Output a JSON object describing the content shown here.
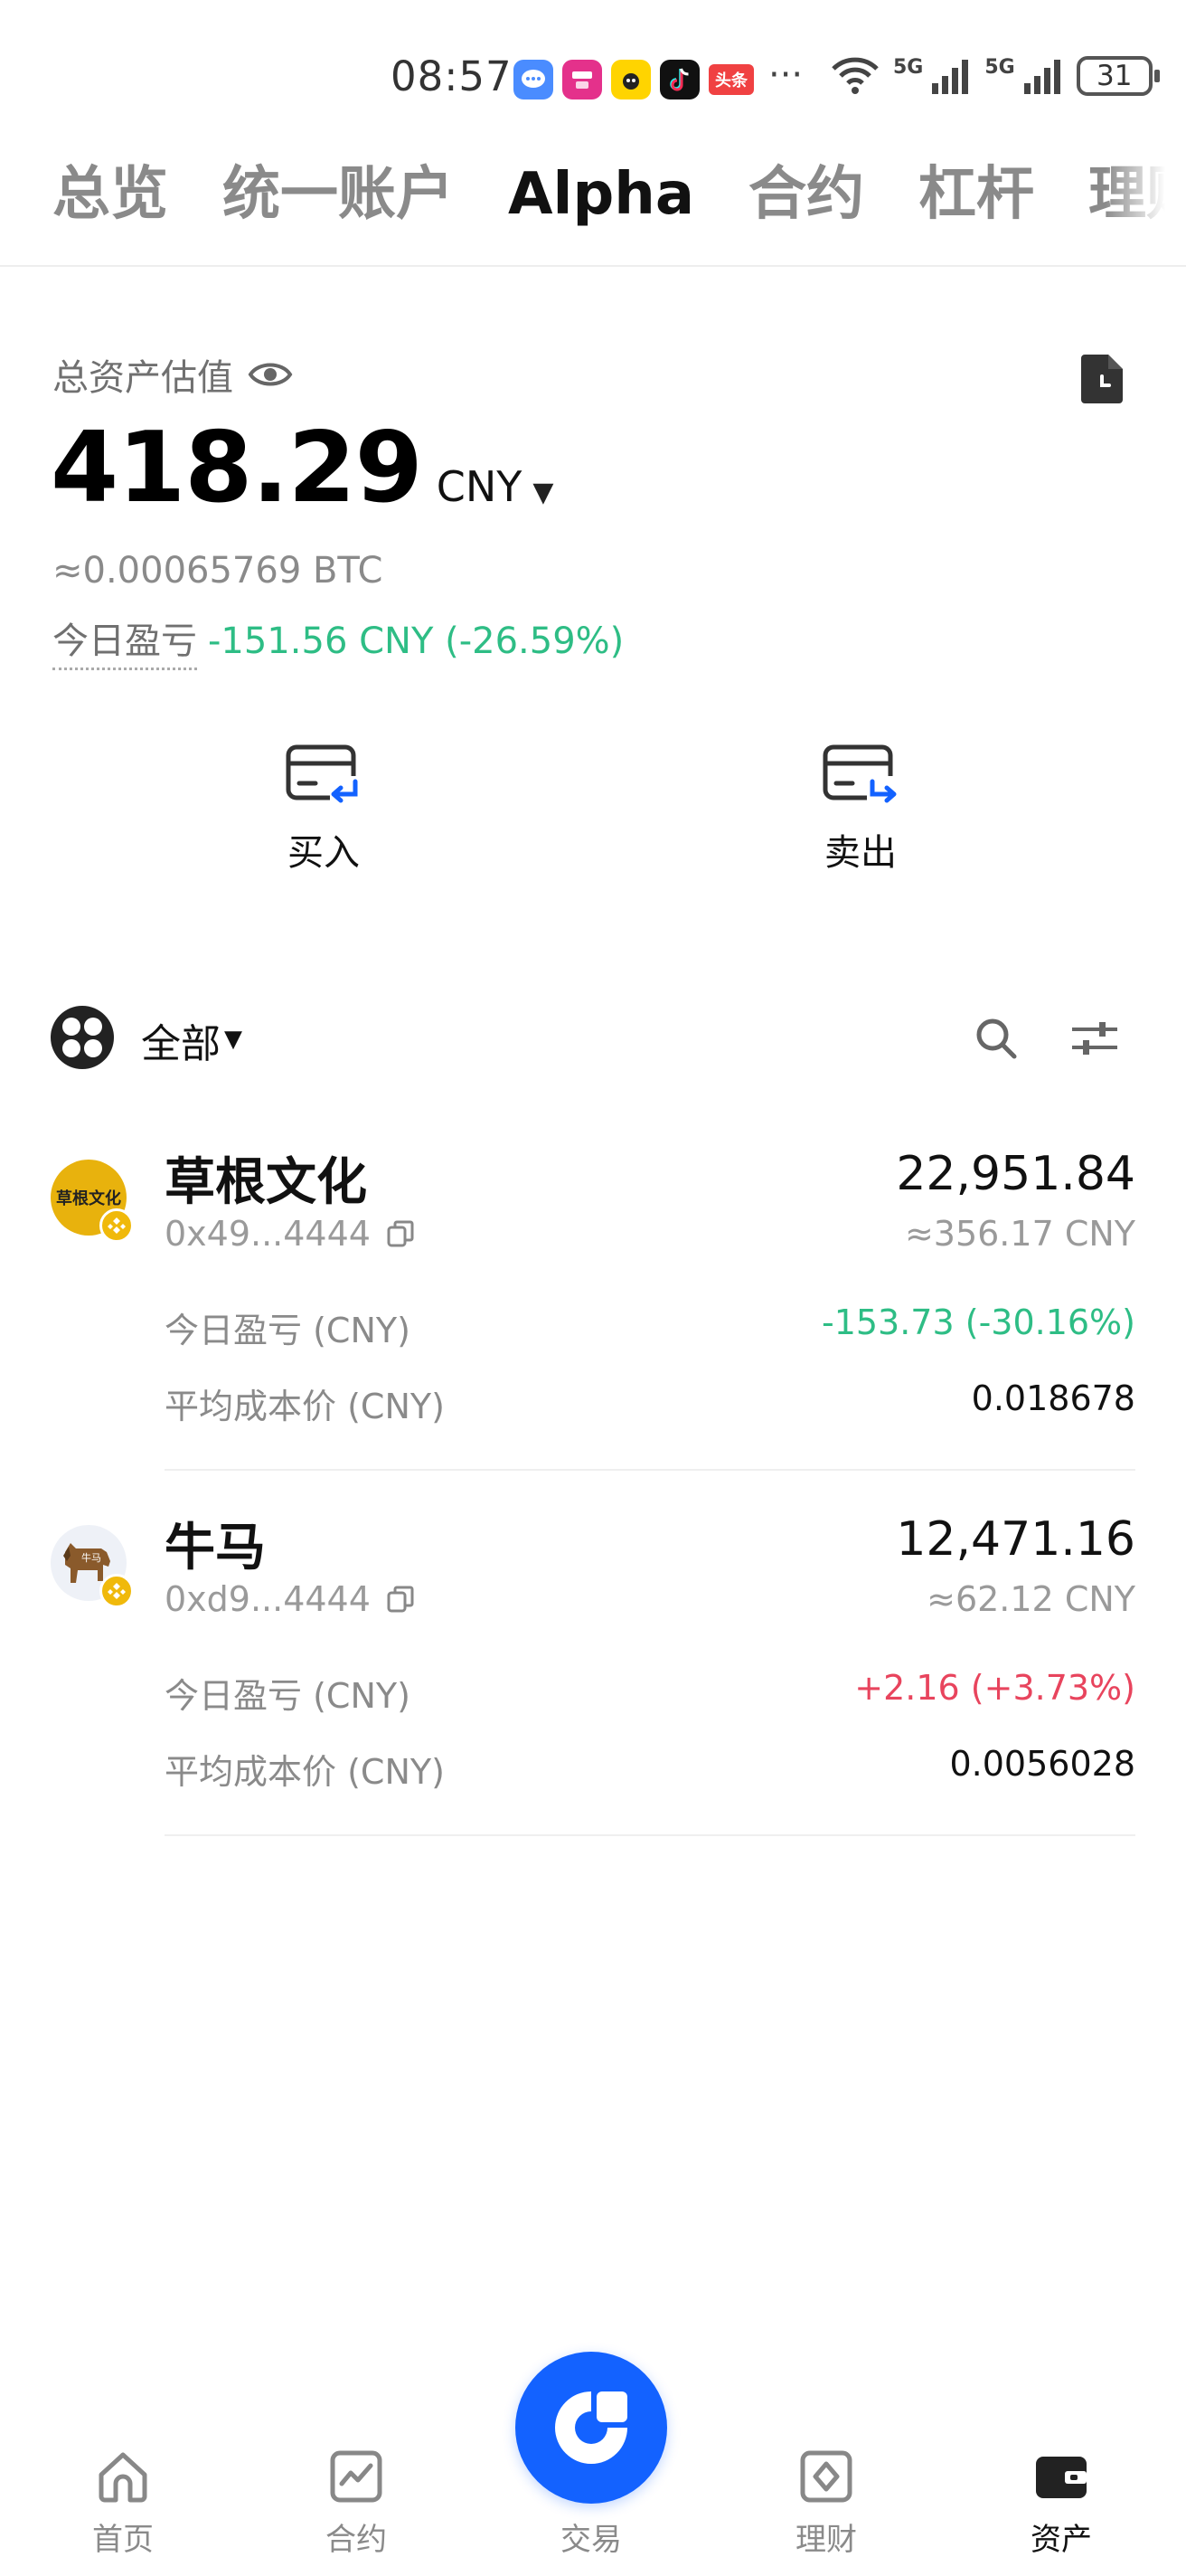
{
  "status_bar": {
    "time": "08:57",
    "app_icons": [
      "message-app-icon",
      "vipshop-app-icon",
      "fanqie-app-icon",
      "tiktok-app-icon",
      "toutiao-app-icon"
    ],
    "toutiao_label": "头条",
    "more": "···",
    "network": [
      "5G",
      "5G"
    ],
    "battery": "31"
  },
  "top_tabs": [
    "总览",
    "统一账户",
    "Alpha",
    "合约",
    "杠杆",
    "理财"
  ],
  "active_tab": "Alpha",
  "summary": {
    "label": "总资产估值",
    "total_value": "418.29",
    "unit": "CNY",
    "btc_value": "≈0.00065769 BTC",
    "pnl_label": "今日盈亏",
    "pnl_value": "-151.56 CNY (-26.59%)"
  },
  "actions": {
    "buy": "买入",
    "sell": "卖出"
  },
  "filter": {
    "label": "全部"
  },
  "tokens": [
    {
      "name": "草根文化",
      "logo_text": "草根文化",
      "address": "0x49...4444",
      "quantity": "22,951.84",
      "value_cny": "≈356.17 CNY",
      "pnl_label": "今日盈亏 (CNY)",
      "pnl_value": "-153.73 (-30.16%)",
      "cost_label": "平均成本价 (CNY)",
      "cost_value": "0.018678"
    },
    {
      "name": "牛马",
      "address": "0xd9...4444",
      "quantity": "12,471.16",
      "value_cny": "≈62.12 CNY",
      "pnl_label": "今日盈亏 (CNY)",
      "pnl_value": "+2.16 (+3.73%)",
      "cost_label": "平均成本价 (CNY)",
      "cost_value": "0.0056028"
    }
  ],
  "bottom_nav": {
    "home": "首页",
    "futures": "合约",
    "trade": "交易",
    "earn": "理财",
    "assets": "资产",
    "active": "资产"
  },
  "colors": {
    "brand_blue": "#1362ff",
    "profit_green": "#2ebd85",
    "loss_red": "#e8445d",
    "bnb_yellow": "#f0b90b"
  }
}
